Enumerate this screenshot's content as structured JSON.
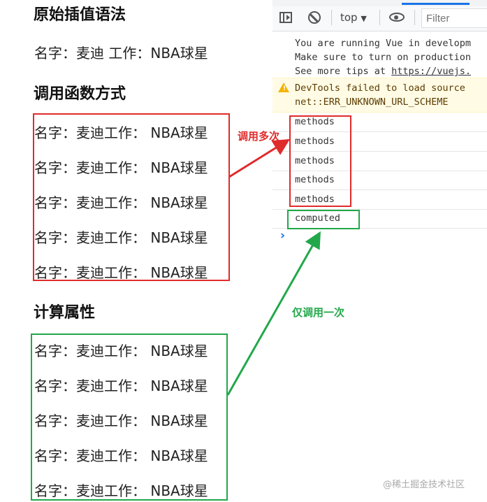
{
  "page": {
    "section1": {
      "heading": "原始插值语法",
      "line": "名字：麦迪 工作：NBA球星"
    },
    "section2": {
      "heading": "调用函数方式",
      "lines": [
        "名字：麦迪工作： NBA球星",
        "名字：麦迪工作： NBA球星",
        "名字：麦迪工作： NBA球星",
        "名字：麦迪工作： NBA球星",
        "名字：麦迪工作： NBA球星"
      ]
    },
    "section3": {
      "heading": "计算属性",
      "lines": [
        "名字：麦迪工作： NBA球星",
        "名字：麦迪工作： NBA球星",
        "名字：麦迪工作： NBA球星",
        "名字：麦迪工作： NBA球星",
        "名字：麦迪工作： NBA球星"
      ]
    }
  },
  "devtools": {
    "context": "top",
    "filter_placeholder": "Filter",
    "messages": [
      "You are running Vue in developm",
      "Make sure to turn on production",
      "See more tips at "
    ],
    "link": "https://vuejs.",
    "warning": [
      "DevTools failed to load source",
      "net::ERR_UNKNOWN_URL_SCHEME"
    ],
    "logs": [
      "methods",
      "methods",
      "methods",
      "methods",
      "methods",
      "computed"
    ],
    "prompt": "›"
  },
  "annotations": {
    "red": "调用多次",
    "green": "仅调用一次",
    "red_color": "#e02b2b",
    "green_color": "#22a84a"
  },
  "watermark": "@稀土掘金技术社区"
}
